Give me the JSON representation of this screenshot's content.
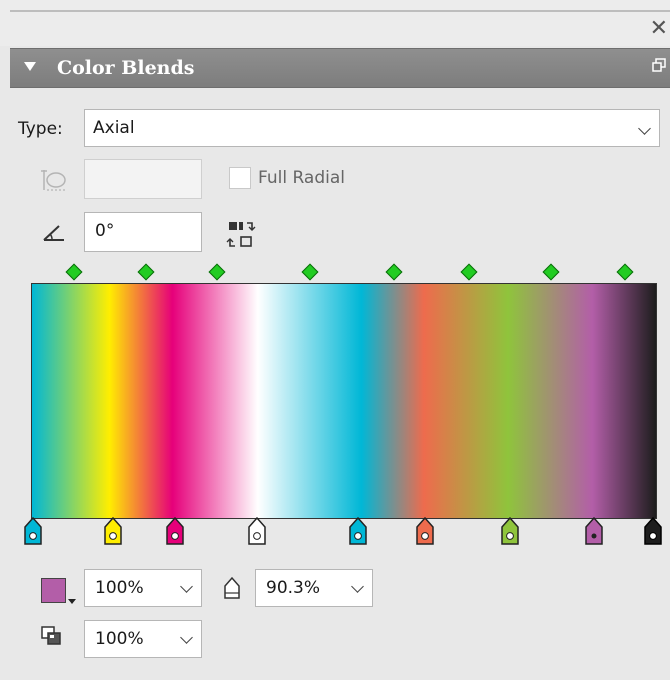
{
  "panel": {
    "title": "Color Blends",
    "type_label": "Type:",
    "type_value": "Axial",
    "full_radial_label": "Full Radial",
    "angle_value": "0°",
    "fill_opacity": "100%",
    "stop_opacity": "90.3%",
    "overprint_opacity": "100%"
  },
  "gradient": {
    "stops": [
      {
        "color": "#00b7d6"
      },
      {
        "color": "#ffee00"
      },
      {
        "color": "#e6007a"
      },
      {
        "color": "#ffffff"
      },
      {
        "color": "#00b7d6"
      },
      {
        "color": "#ee6b4d"
      },
      {
        "color": "#8fc43c"
      },
      {
        "color": "#b35ea8"
      },
      {
        "color": "#1d1d1d"
      }
    ],
    "midpoint_count": 8,
    "midpoint_color": "#22cc22",
    "selected_stop_color": "#b35ea8"
  },
  "icons": {
    "close": "close-icon",
    "collapse": "collapse-triangle-icon",
    "float": "float-panel-icon",
    "radius": "radius-icon",
    "angle": "angle-icon",
    "reverse": "reverse-gradient-icon",
    "opacity": "opacity-icon",
    "overprint": "overprint-icon"
  }
}
